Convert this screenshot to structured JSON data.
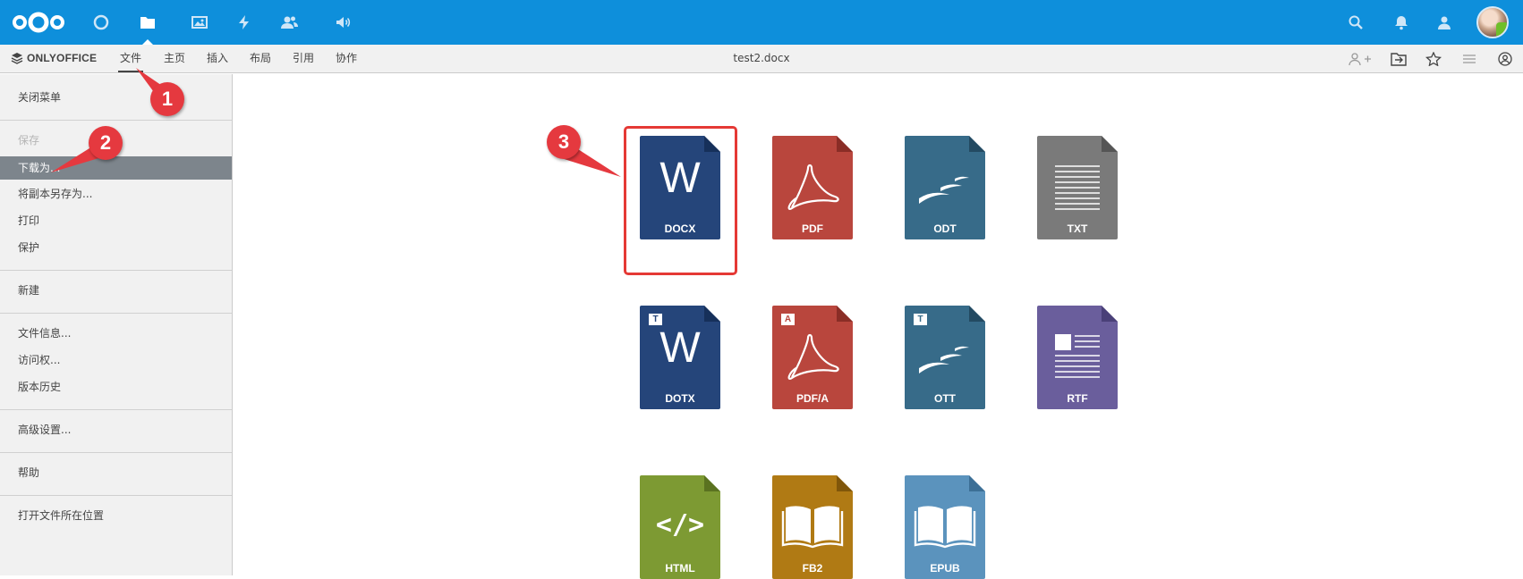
{
  "topbar": {
    "bg": "#0e8fdb",
    "app_icons": [
      "dashboard-icon",
      "files-icon",
      "photos-icon",
      "activity-icon",
      "contacts-icon",
      "talk-icon"
    ],
    "active_app": "files-icon",
    "right_icons": [
      "search-icon",
      "bell-icon",
      "contacts-menu-icon",
      "avatar"
    ]
  },
  "editor": {
    "brand": "ONLYOFFICE",
    "tabs": [
      "文件",
      "主页",
      "插入",
      "布局",
      "引用",
      "协作"
    ],
    "active_tab": "文件",
    "doc_title": "test2.docx",
    "right_icons": [
      "share-user-icon",
      "open-location-icon",
      "favorite-star-icon",
      "hamburger-icon",
      "user-icon"
    ]
  },
  "menu": {
    "items": [
      {
        "label": "关闭菜单",
        "state": "normal"
      },
      {
        "label": "保存",
        "state": "disabled"
      },
      {
        "label": "下载为...",
        "state": "selected"
      },
      {
        "label": "将副本另存为...",
        "state": "normal"
      },
      {
        "label": "打印",
        "state": "normal"
      },
      {
        "label": "保护",
        "state": "normal"
      },
      {
        "label": "新建",
        "state": "normal"
      },
      {
        "label": "文件信息...",
        "state": "normal"
      },
      {
        "label": "访问权...",
        "state": "normal"
      },
      {
        "label": "版本历史",
        "state": "normal"
      },
      {
        "label": "高级设置...",
        "state": "normal"
      },
      {
        "label": "帮助",
        "state": "normal"
      },
      {
        "label": "打开文件所在位置",
        "state": "normal"
      }
    ]
  },
  "formats": [
    {
      "label": "DOCX",
      "color": "#25457a",
      "glyph": "W",
      "selected": true
    },
    {
      "label": "PDF",
      "color": "#b9463d",
      "glyph": "acrobat"
    },
    {
      "label": "ODT",
      "color": "#376b89",
      "glyph": "gulls"
    },
    {
      "label": "TXT",
      "color": "#7a7a7a",
      "glyph": "lines"
    },
    {
      "label": "DOTX",
      "color": "#25457a",
      "glyph": "W",
      "badge": "T"
    },
    {
      "label": "PDF/A",
      "color": "#b9463d",
      "glyph": "acrobat",
      "badge": "A"
    },
    {
      "label": "OTT",
      "color": "#376b89",
      "glyph": "gulls",
      "badge": "T"
    },
    {
      "label": "RTF",
      "color": "#6a5e9c",
      "glyph": "rtf"
    },
    {
      "label": "HTML",
      "color": "#7d9a33",
      "glyph": "</>"
    },
    {
      "label": "FB2",
      "color": "#b07a14",
      "glyph": "book"
    },
    {
      "label": "EPUB",
      "color": "#5b93bd",
      "glyph": "book"
    }
  ],
  "annotations": {
    "step1": "1",
    "step2": "2",
    "step3": "3",
    "color": "#e5393f"
  }
}
